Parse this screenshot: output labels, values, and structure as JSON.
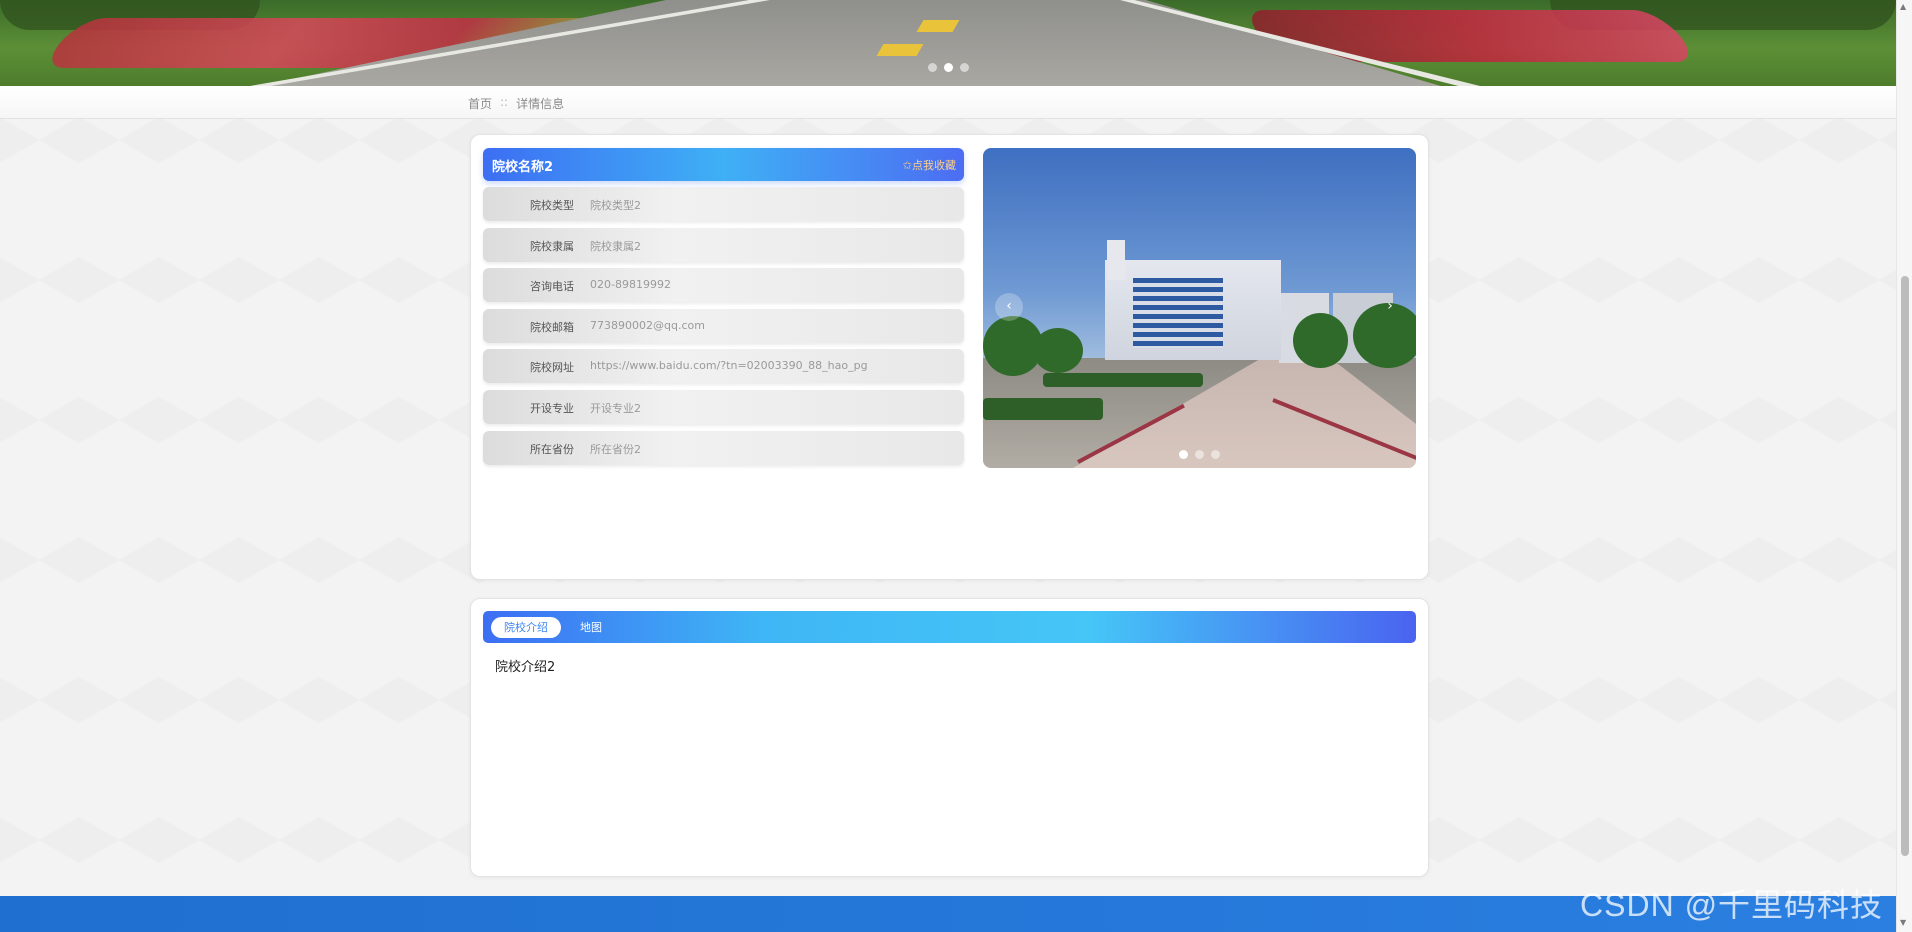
{
  "banner": {
    "dots": [
      {
        "active": false
      },
      {
        "active": true
      },
      {
        "active": false
      }
    ]
  },
  "breadcrumb": {
    "home": "首页",
    "separator": "::",
    "current": "详情信息"
  },
  "detail": {
    "title": "院校名称2",
    "favorite_label": "✩点我收藏",
    "fields": [
      {
        "label": "院校类型",
        "value": "院校类型2"
      },
      {
        "label": "院校隶属",
        "value": "院校隶属2"
      },
      {
        "label": "咨询电话",
        "value": "020-89819992"
      },
      {
        "label": "院校邮箱",
        "value": "773890002@qq.com"
      },
      {
        "label": "院校网址",
        "value": "https://www.baidu.com/?tn=02003390_88_hao_pg"
      },
      {
        "label": "开设专业",
        "value": "开设专业2"
      },
      {
        "label": "所在省份",
        "value": "所在省份2"
      }
    ]
  },
  "carousel": {
    "prev_icon": "‹",
    "next_icon": "›",
    "dots": [
      {
        "active": true
      },
      {
        "active": false
      },
      {
        "active": false
      }
    ]
  },
  "tabs": {
    "items": [
      {
        "label": "院校介绍",
        "active": true
      },
      {
        "label": "地图",
        "active": false
      }
    ],
    "content": "院校介绍2"
  },
  "watermark": "CSDN @千里码科技",
  "colors": {
    "accent_blue": "#3d6ef3",
    "accent_cyan": "#3fb6f5",
    "footer_blue": "#1f6fd0",
    "favorite_orange": "#ffd089"
  }
}
